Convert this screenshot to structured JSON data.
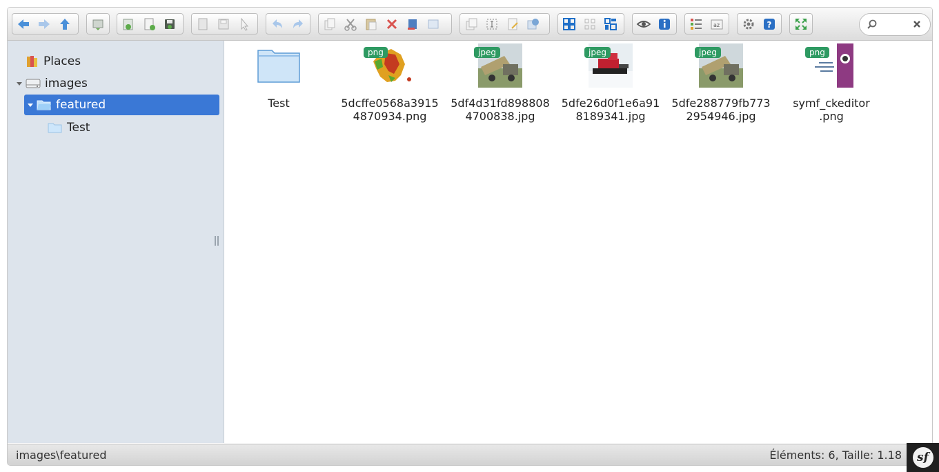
{
  "toolbar": {
    "groups": [
      [
        "back-icon",
        "forward-icon",
        "up-icon"
      ],
      [
        "reload-icon"
      ],
      [
        "mkdir-icon",
        "mkfile-icon",
        "upload-icon"
      ],
      [
        "open-icon",
        "download-icon",
        "getfile-icon"
      ],
      [
        "undo-icon",
        "redo-icon"
      ],
      [
        "copy-icon",
        "cut-icon",
        "paste-icon",
        "delete-icon",
        "empty-icon",
        "hide-icon"
      ],
      [
        "duplicate-icon",
        "rename-icon",
        "edit-icon",
        "resize-icon"
      ],
      [
        "select-all-icon",
        "select-none-icon",
        "select-invert-icon"
      ],
      [
        "view-icon",
        "info-icon"
      ],
      [
        "list-view-icon",
        "sort-icon"
      ],
      [
        "settings-icon",
        "help-icon"
      ],
      [
        "fullscreen-icon"
      ]
    ]
  },
  "search": {
    "icon": "search-icon",
    "clear_icon": "clear-icon"
  },
  "sidebar": {
    "items": [
      {
        "label": "Places",
        "icon": "places-icon"
      },
      {
        "label": "images",
        "icon": "drive-icon"
      },
      {
        "label": "featured",
        "icon": "folder-open-icon"
      },
      {
        "label": "Test",
        "icon": "folder-icon"
      }
    ]
  },
  "files": [
    {
      "name_line1": "Test",
      "name_line2": "",
      "badge": "",
      "kind": "folder"
    },
    {
      "name_line1": "5dcffe0568a3915",
      "name_line2": "4870934.png",
      "badge": "png",
      "kind": "map"
    },
    {
      "name_line1": "5df4d31fd898808",
      "name_line2": "4700838.jpg",
      "badge": "jpeg",
      "kind": "photo-truck"
    },
    {
      "name_line1": "5dfe26d0f1e6a91",
      "name_line2": "8189341.jpg",
      "badge": "jpeg",
      "kind": "photo-groomer"
    },
    {
      "name_line1": "5dfe288779fb773",
      "name_line2": "2954946.jpg",
      "badge": "jpeg",
      "kind": "photo-truck"
    },
    {
      "name_line1": "symf_ckeditor",
      "name_line2": ".png",
      "badge": "png",
      "kind": "ckeditor-tutorial"
    }
  ],
  "status": {
    "path": "images\\featured",
    "info": "Éléments: 6, Taille: 1.18"
  },
  "symfony_badge": {
    "icon": "symfony-icon",
    "letters": "sf"
  },
  "colors": {
    "accent": "#3a78d6",
    "badge": "#2e9a62",
    "sidebar_bg": "#dde4ec"
  }
}
